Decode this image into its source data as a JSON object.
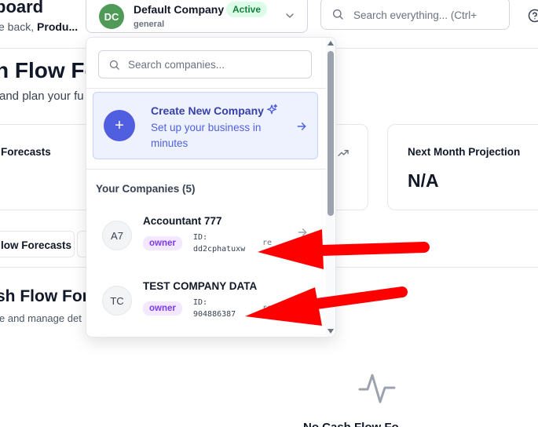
{
  "header": {
    "title": "board",
    "subtitle_prefix": "e back, ",
    "subtitle_bold": "Produ...",
    "company_switcher": {
      "avatar_initials": "DC",
      "name": "Default Company",
      "status": "Active",
      "subtext": "general",
      "icon": "chevron-down-icon"
    },
    "search": {
      "placeholder": "Search everything... (Ctrl+",
      "icon": "search-icon"
    },
    "help_icon": "help-circle-icon"
  },
  "page": {
    "heading": "n Flow Fo",
    "description": "and plan your fu"
  },
  "cards": {
    "forecasts_label": "Forecasts",
    "mid_icon": "trending-up-icon",
    "projection_label": "Next Month Projection",
    "projection_value": "N/A"
  },
  "tabs": {
    "active": "low Forecasts"
  },
  "section": {
    "title": "sh Flow For",
    "description": "e and manage det",
    "empty_icon": "activity-icon",
    "empty_title": "No Cash Flow Fo"
  },
  "dropdown": {
    "search_placeholder": "Search companies...",
    "create": {
      "title": "Create New Company",
      "subtitle": "Set up your business in minutes",
      "icons": [
        "plus-icon",
        "sparkles-icon",
        "arrow-right-icon"
      ]
    },
    "companies_header": "Your Companies (5)",
    "companies": [
      {
        "initials": "A7",
        "name": "Accountant 777",
        "role": "owner",
        "id_label": "ID:",
        "id_value": "dd2cphatuxw",
        "extra": "re"
      },
      {
        "initials": "TC",
        "name": "TEST COMPANY DATA",
        "role": "owner",
        "id_label": "ID:",
        "id_value": "904886387",
        "extra": "re"
      }
    ]
  },
  "colors": {
    "accent": "#4f5fe0",
    "active_badge_bg": "#dcfce7",
    "active_badge_text": "#15803d",
    "owner_badge_bg": "#f3e8ff",
    "owner_badge_text": "#7c3aed",
    "annotation_arrow": "#ff0000"
  }
}
